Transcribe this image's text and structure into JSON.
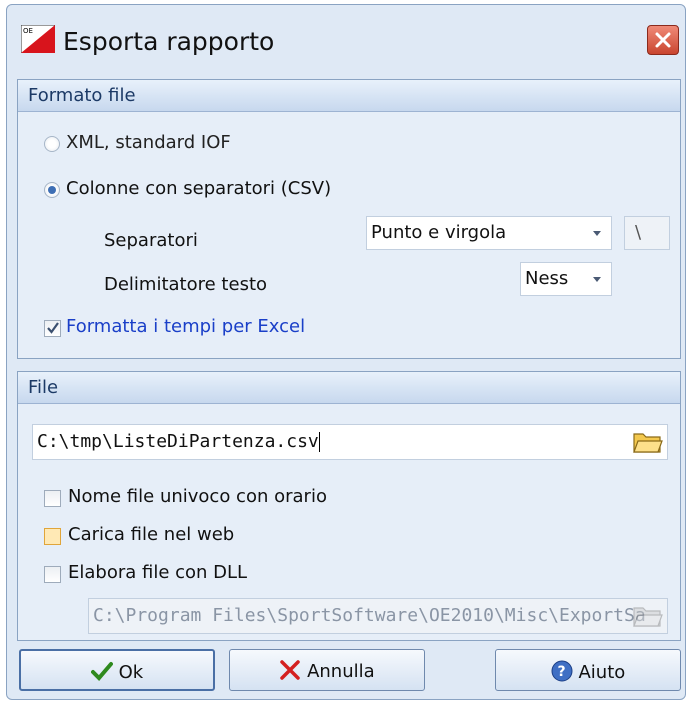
{
  "dialog": {
    "title": "Esporta rapporto"
  },
  "formato": {
    "header": "Formato file",
    "xml_label": "XML, standard IOF",
    "csv_label": "Colonne con separatori (CSV)",
    "separatori_label": "Separatori",
    "separatori_value": "Punto e virgola",
    "separatori_custom": "\\",
    "delimitatore_label": "Delimitatore testo",
    "delimitatore_value": "Ness",
    "excel_label": "Formatta i tempi per Excel"
  },
  "file": {
    "header": "File",
    "path": "C:\\tmp\\ListeDiPartenza.csv",
    "unique_label": "Nome file univoco con orario",
    "web_label": "Carica file nel web",
    "dll_label": "Elabora file con DLL",
    "dll_path": "C:\\Program Files\\SportSoftware\\OE2010\\Misc\\ExportSa"
  },
  "buttons": {
    "ok": "Ok",
    "cancel": "Annulla",
    "help": "Aiuto"
  },
  "state": {
    "selected_format": "csv",
    "excel_checked": true,
    "unique_checked": false,
    "web_checked": false,
    "dll_checked": false
  },
  "colors": {
    "accent": "#1a3fc8",
    "header_text": "#1c3a66"
  }
}
